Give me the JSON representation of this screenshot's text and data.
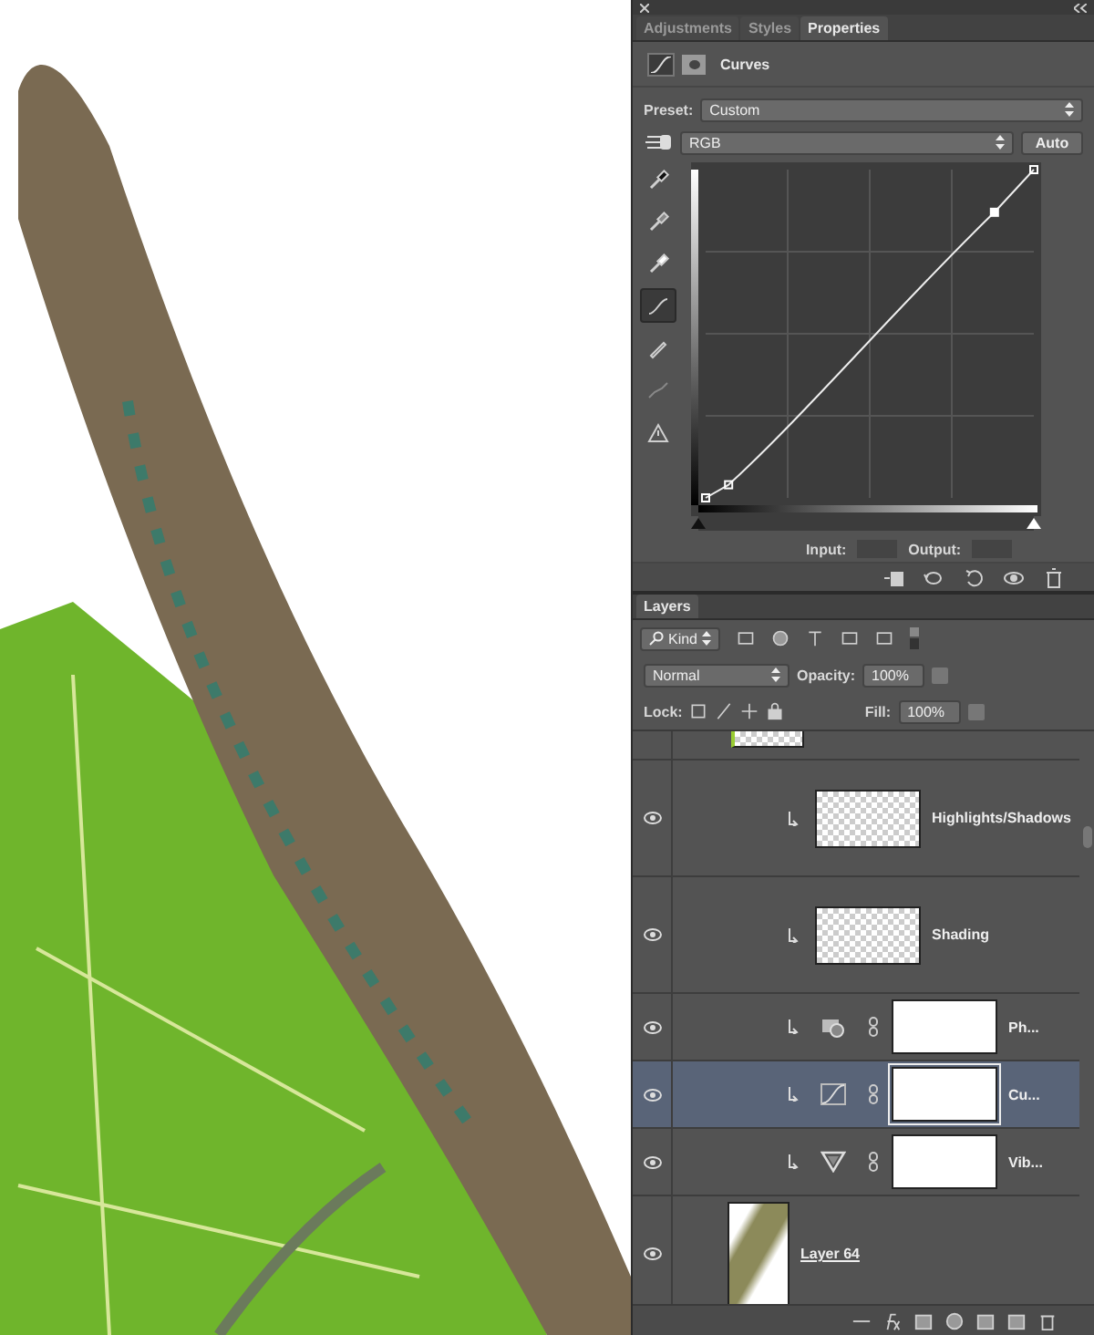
{
  "properties_panel": {
    "tabs": [
      {
        "label": "Adjustments",
        "selected": false
      },
      {
        "label": "Styles",
        "selected": false
      },
      {
        "label": "Properties",
        "selected": true
      }
    ],
    "title": "Curves",
    "preset_label": "Preset:",
    "preset": "Custom",
    "channel": "RGB",
    "auto_button": "Auto",
    "tools": [
      {
        "kind": "eyedropper-black",
        "selected": false
      },
      {
        "kind": "eyedropper-gray",
        "selected": false
      },
      {
        "kind": "eyedropper-white",
        "selected": false
      },
      {
        "kind": "curve",
        "selected": true
      },
      {
        "kind": "pencil",
        "selected": false
      },
      {
        "kind": "smooth",
        "selected": false
      },
      {
        "kind": "warning",
        "selected": false
      }
    ],
    "input_sliders": [
      {
        "kind": "shadow",
        "level": 0
      },
      {
        "kind": "highlight",
        "level": 1
      }
    ],
    "input_label": "Input:",
    "output_label": "Output:"
  },
  "layers_panel": {
    "tabs": [
      {
        "label": "Layers",
        "selected": true
      }
    ],
    "filter": "Kind",
    "blend_mode": "Normal",
    "opacity_label": "Opacity:",
    "opacity": "100%",
    "lock_label": "Lock:",
    "fill_label": "Fill:",
    "fill": "100%",
    "layers": [
      {
        "kind": "cut",
        "visible": false,
        "selected": false
      },
      {
        "kind": "pixel",
        "name": "Highlights/Shadows",
        "visible": true,
        "selected": false,
        "clipped": true
      },
      {
        "kind": "pixel",
        "name": "Shading",
        "visible": true,
        "selected": false,
        "clipped": true
      },
      {
        "kind": "photo-filter",
        "name": "Ph...",
        "visible": true,
        "selected": false,
        "clipped": true
      },
      {
        "kind": "curves",
        "name": "Cu...",
        "visible": true,
        "selected": true,
        "clipped": true
      },
      {
        "kind": "vibrance",
        "name": "Vib...",
        "visible": true,
        "selected": false,
        "clipped": true
      },
      {
        "kind": "image",
        "name": "Layer 64",
        "visible": true,
        "selected": false,
        "clipped": false
      }
    ]
  }
}
